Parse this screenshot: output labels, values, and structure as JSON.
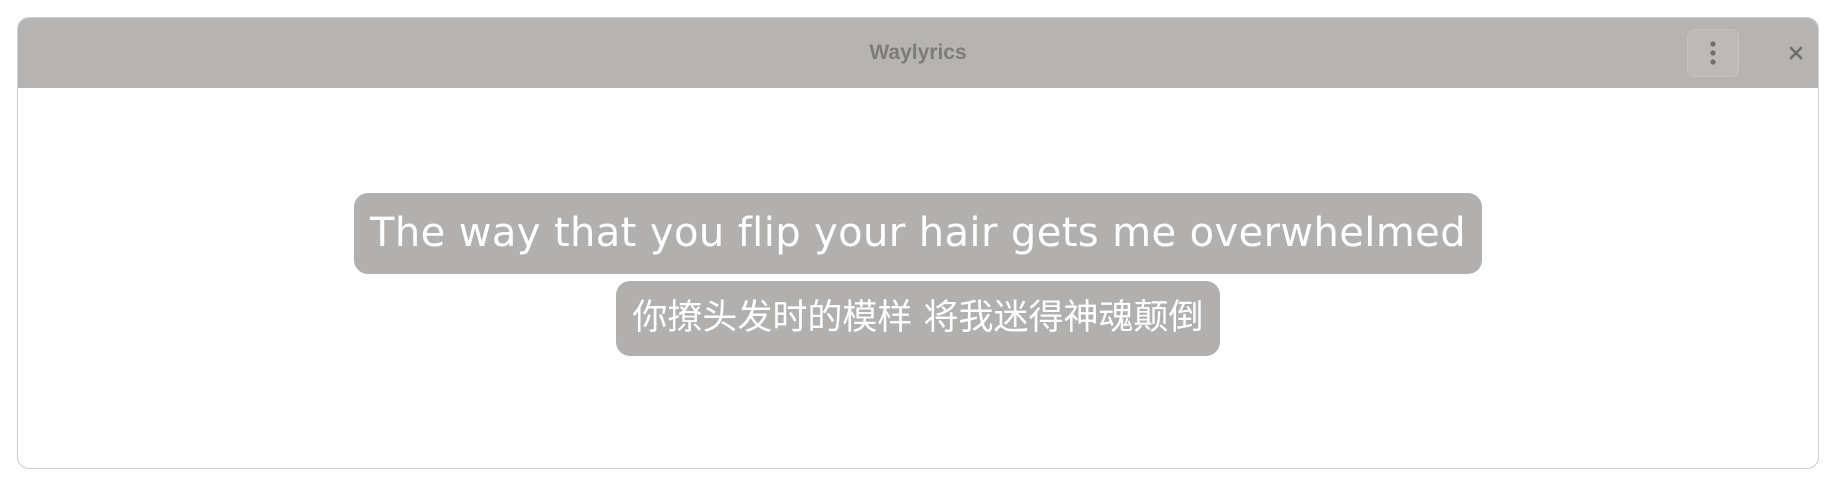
{
  "window": {
    "title": "Waylyrics",
    "menu_icon": "vertical-ellipsis-icon",
    "close_icon": "close-icon"
  },
  "lyrics": {
    "current_line": "The way that you flip your hair gets me overwhelmed",
    "translation_line": "你撩头发时的模样 将我迷得神魂颠倒"
  },
  "colors": {
    "titlebar_bg": "#b5b4b2",
    "title_text": "#7d7c7a",
    "lyric_bg": "#b1b0ae",
    "lyric_text": "#ffffff"
  }
}
